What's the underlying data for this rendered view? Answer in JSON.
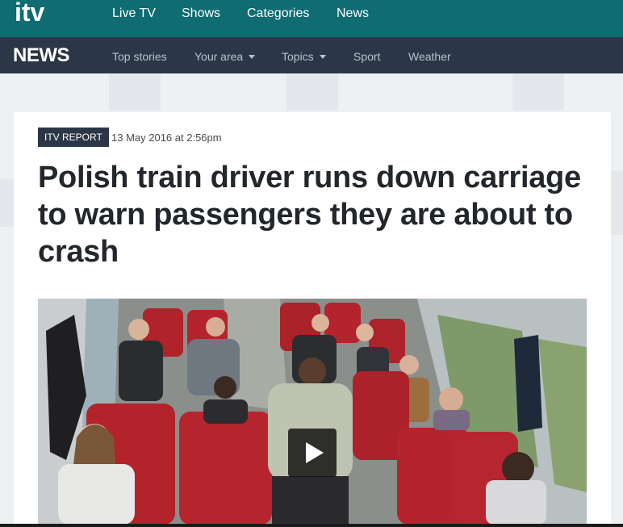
{
  "brand": {
    "logo_text": "itv"
  },
  "top_nav": {
    "items": [
      "Live TV",
      "Shows",
      "Categories",
      "News"
    ]
  },
  "news_nav": {
    "logo": "NEWS",
    "items": [
      {
        "label": "Top stories",
        "dropdown": false
      },
      {
        "label": "Your area",
        "dropdown": true
      },
      {
        "label": "Topics",
        "dropdown": true
      },
      {
        "label": "Sport",
        "dropdown": false
      },
      {
        "label": "Weather",
        "dropdown": false
      }
    ]
  },
  "article": {
    "badge": "ITV REPORT",
    "date": "13 May 2016 at 2:56pm",
    "headline": "Polish train driver runs down carriage to warn passengers they are about to crash"
  },
  "video": {
    "thumbnail": "train-carriage-cctv",
    "play_icon": "play-icon"
  },
  "colors": {
    "top_bar": "#0e6c72",
    "news_bar": "#2b3646",
    "badge_bg": "#2b3646",
    "headline": "#23272c"
  }
}
